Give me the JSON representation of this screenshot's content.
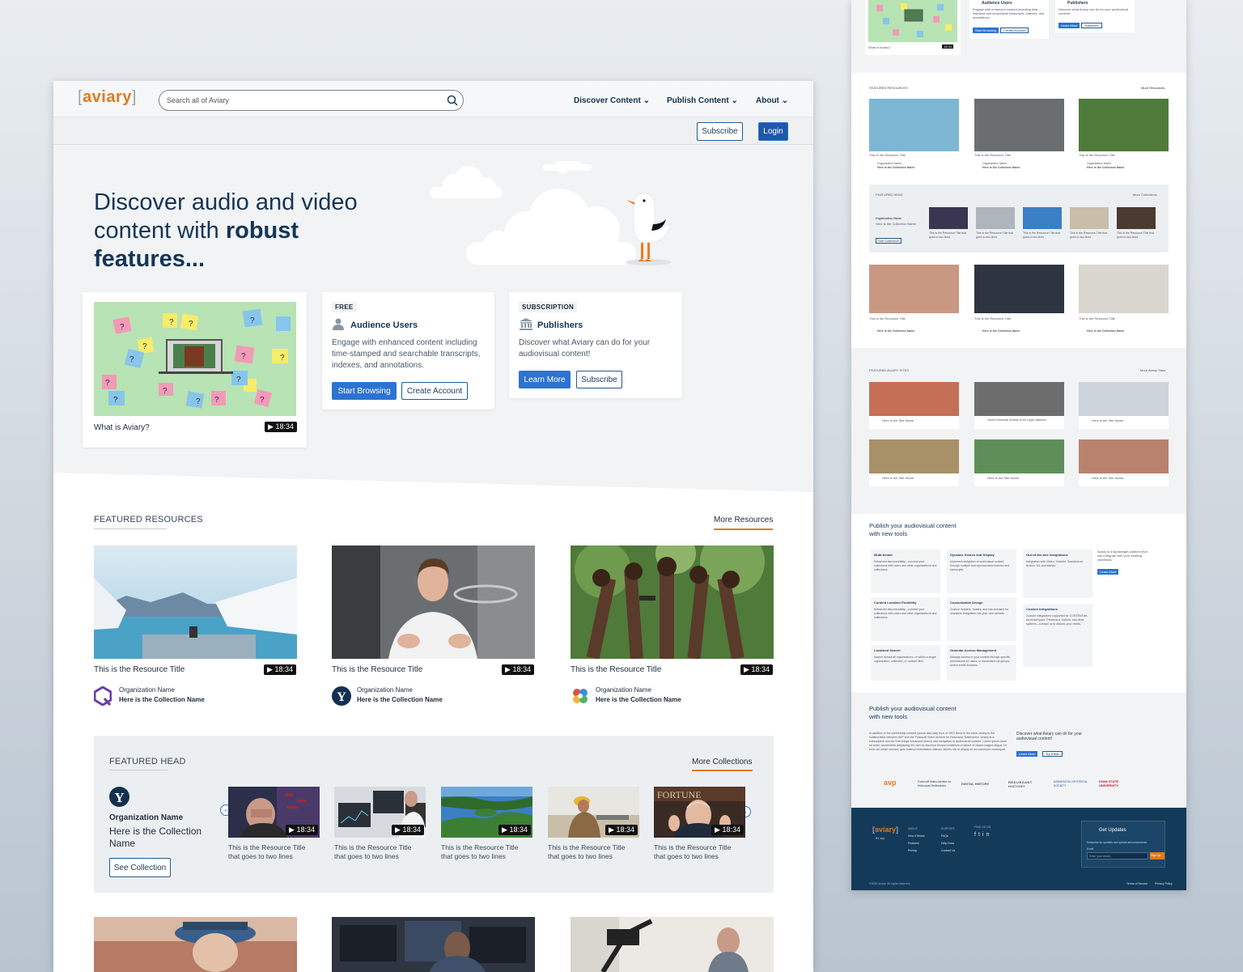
{
  "header": {
    "logo_text": "aviary",
    "search_placeholder": "Search all of Aviary",
    "nav": [
      "Discover Content",
      "Publish Content",
      "About"
    ],
    "subscribe": "Subscribe",
    "login": "Login"
  },
  "hero": {
    "title_line1": "Discover audio and video",
    "title_line2a": "content with ",
    "title_line2b": "robust",
    "title_line3": "features...",
    "video_title": "What is Aviary?",
    "video_duration": "18:34",
    "free_tag": "FREE",
    "audience_title": "Audience Users",
    "audience_text": "Engage with enhanced content including time-stamped and searchable transcripts, indexes, and annotations.",
    "start_browsing": "Start Browsing",
    "create_account": "Create Account",
    "sub_tag": "SUBSCRIPTION",
    "publishers_title": "Publishers",
    "publishers_text": "Discover what Aviary can do for your audiovisual content!",
    "learn_more": "Learn More",
    "subscribe": "Subscribe"
  },
  "featured_resources": {
    "heading": "FEATURED RESOURCES",
    "more": "More Resources",
    "items": [
      {
        "title": "This is the Resource Title",
        "duration": "18:34",
        "org": "Organization Name",
        "collection": "Here is the Collection Name",
        "logo": "q-logo"
      },
      {
        "title": "This is the Resource Title",
        "duration": "18:34",
        "org": "Organization Name",
        "collection": "Here is the Collection Name",
        "logo": "y-logo"
      },
      {
        "title": "This is the Resource Title",
        "duration": "18:34",
        "org": "Organization Name",
        "collection": "Here is the Collection Name",
        "logo": "flower-logo"
      }
    ]
  },
  "featured_head": {
    "heading": "FEATURED HEAD",
    "more": "More Collections",
    "org": "Organization Name",
    "collection": "Here is the Collection Name",
    "see_collection": "See Collection",
    "items": [
      {
        "title": "This is the Resource Title that goes to two lines",
        "duration": "18:34"
      },
      {
        "title": "This is the Resource Title that goes to two lines",
        "duration": "18:34"
      },
      {
        "title": "This is the Resource Title that goes to two lines",
        "duration": "18:34"
      },
      {
        "title": "This is the Resource Title that goes to two lines",
        "duration": "18:34"
      },
      {
        "title": "This is the Resource Title that goes to two lines",
        "duration": "18:34"
      }
    ]
  },
  "side": {
    "top_video": "What is Aviary?",
    "top_duration": "18:34",
    "audience": "Audience Users",
    "audience_text": "Engage with enhanced content including time-stamped and searchable transcripts, indexes, and annotations.",
    "publishers": "Publishers",
    "publishers_text": "Discover what Aviary can do for your audiovisual content!",
    "start_browsing": "Start Browsing",
    "create_account": "Create Account",
    "learn_more": "Learn More",
    "subscribe": "Subscribe",
    "featured_resources": "FEATURED RESOURCES",
    "more_resources": "More Resources",
    "resource_title": "This is the Resource Title",
    "duration": "18:34",
    "org": "Organization Name",
    "collection": "Here is the Collection Name",
    "featured_head": "FEATURED HEAD",
    "more_collections": "More Collections",
    "head_collection": "Here is the Collection Name",
    "see_collection": "See Collection",
    "two_lines": "This is the Resource Title that goes to two lines",
    "featured_sites": "FEATURED AVIARY SITES",
    "more_sites": "More Aviary Sites",
    "site_name": "Here is the Site Name",
    "site_jewish": "Jewish Historical Society of the Upper Midwest",
    "publish_heading_1": "Publish your audiovisual content",
    "publish_heading_2": "with new tools",
    "features": [
      {
        "title": "Multi-tenant",
        "text": "Enhanced discoverability—connect your collections with users and other organizations and collections."
      },
      {
        "title": "Dynamic Search and Display",
        "text": "Improved navigation of audiovisual content through multiple and synchronized indexes and transcripts."
      },
      {
        "title": "Out-of-the-box Integrations",
        "text": "Integration with Vimeo, Youtube, Soundcloud, Avalon, S3, and friends."
      },
      {
        "title": "Content Location Flexibility",
        "text": "Enhanced discoverability—connect your collections with users and other organizations and collections."
      },
      {
        "title": "Customizable Design",
        "text": "Custom headers, footers, and sub-domains for seamless integration into your own website."
      },
      {
        "title": "Custom Integrations",
        "text": "Custom integrations supported for CONTENTdm, ArchivesSpace, Preservica, Kaltura, and other systems—contact us to discuss your needs."
      },
      {
        "title": "Localized Search",
        "text": "Search across all organizations, or within a single organization, collection, or content item."
      },
      {
        "title": "Granular Access Management",
        "text": "Manage access to your content through specific permissions for users, or associated via groups, and/or email domains."
      }
    ],
    "aside_text": "Aviary is a lightweight platform that can integrate with your existing workflows.",
    "aside_btn": "Learn More",
    "body_text": "In addition to the partnership content (would also play from of SEO items in the back. Aviary is the collaboration between AVP and the Fortunoff Video Archive for Holocaust Testimonies. Aviary is a subscription service that brings enhanced search and navigation to audiovisual content. Lorem ipsum dolor sit amet, consectetur adipiscing elit, sed do eiusmod tempor incididunt ut labore et dolore magna aliqua. Ut enim ad minim veniam, quis nostrud exercitation ullamco laboris nisi ut aliquip ex ea commodo consequat.",
    "discover_text": "Discover what Aviary can do for your audiovisual content!",
    "try_it_free": "Try it free",
    "partners": [
      "avp",
      "Fortunoff Video Archive for Holocaust Testimonies",
      "DIGITAL HISTORY",
      "REDUNDANT HISTORY",
      "MINNESOTA HISTORICAL SOCIETY",
      "IOWA STATE UNIVERSITY"
    ],
    "footer": {
      "col1_head": "ABOUT",
      "col1": [
        "How it Works",
        "Features",
        "Pricing"
      ],
      "col2_head": "SUPPORT",
      "col2": [
        "FAQs",
        "Help Docs",
        "Contact Us"
      ],
      "col3_head": "FIND US ON",
      "updates": "Get Updates",
      "updates_text": "Subscribe for updates and special announcements",
      "email_label": "Email",
      "email_placeholder": "Enter your email...",
      "signup": "Sign Up",
      "copyright": "©2019 aviary. All rights reserved.",
      "terms": "Terms of Service",
      "privacy": "Privacy Policy",
      "by": "BY",
      "avp": "avp"
    }
  }
}
